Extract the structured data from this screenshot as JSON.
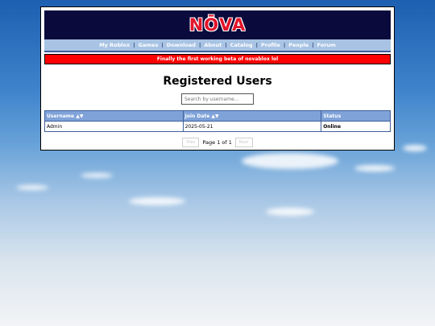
{
  "header": {
    "logo": "NŌVA"
  },
  "nav": {
    "items": [
      "My Roblox",
      "Games",
      "Download",
      "About",
      "Catalog",
      "Profile",
      "People",
      "Forum"
    ],
    "separator": "|"
  },
  "banner": {
    "text": "Finally the first working beta of novablox lol"
  },
  "page": {
    "title": "Registered Users"
  },
  "search": {
    "placeholder": "Search by username..."
  },
  "table": {
    "headers": [
      "Username ▲▼",
      "Join Date ▲▼",
      "Status"
    ],
    "rows": [
      {
        "username": "Admin",
        "join_date": "2025-05-21",
        "status": "Online"
      }
    ]
  },
  "pagination": {
    "prev": "Prev",
    "info": "Page 1 of 1",
    "next": "Next"
  },
  "colors": {
    "topbar": "#0a0a3c",
    "accent_red": "#ff0000",
    "nav": "#a8c3e3",
    "online": "#0a8a0a"
  }
}
